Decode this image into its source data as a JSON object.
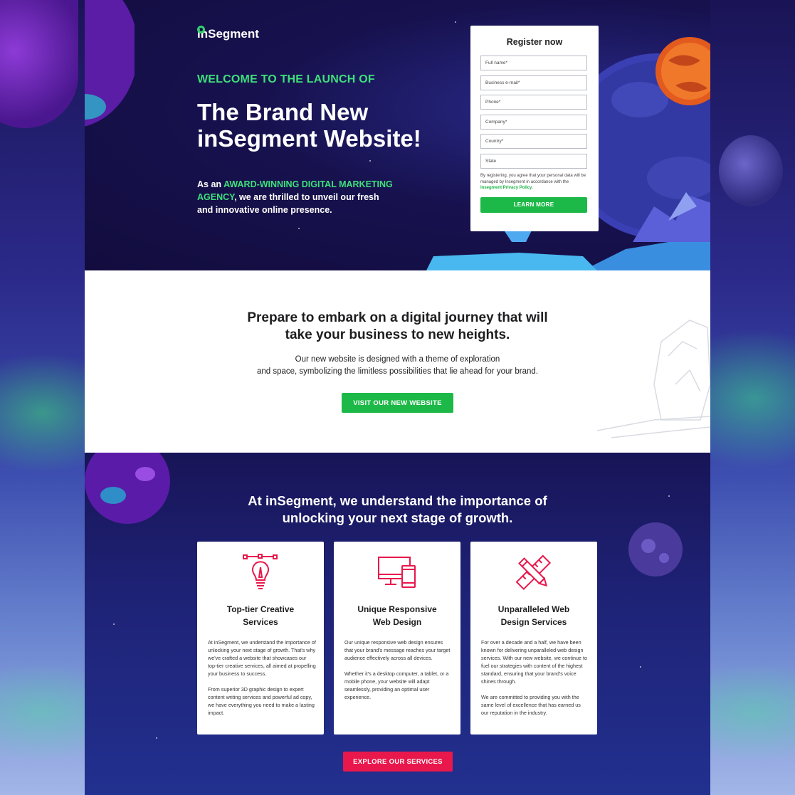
{
  "logo": {
    "text": "inSegment"
  },
  "hero": {
    "kicker": "WELCOME TO THE LAUNCH OF",
    "title_line1": "The Brand New",
    "title_line2": "inSegment Website!",
    "body_prefix": "As an ",
    "body_highlight": "AWARD-WINNING DIGITAL MARKETING AGENCY",
    "body_suffix": ", we are thrilled to unveil our fresh and innovative online presence."
  },
  "form": {
    "title": "Register now",
    "fields": [
      {
        "placeholder": "Full name*"
      },
      {
        "placeholder": "Business e-mail*"
      },
      {
        "placeholder": "Phone*"
      },
      {
        "placeholder": "Company*"
      },
      {
        "placeholder": "Country*"
      },
      {
        "placeholder": "State"
      }
    ],
    "note_prefix": "By registering, you agree that your personal data will be managed by Insegment in accordance with the ",
    "note_link": "Insegment Privacy Policy",
    "note_suffix": ".",
    "submit_label": "LEARN MORE"
  },
  "journey": {
    "title_line1": "Prepare to embark on a digital journey that will",
    "title_line2": "take your business to new heights.",
    "body_line1": "Our new website is designed with a theme of exploration",
    "body_line2": "and space, symbolizing the limitless possibilities that lie ahead for your brand.",
    "button_label": "VISIT OUR NEW WEBSITE"
  },
  "services": {
    "title_line1": "At inSegment, we understand the importance of",
    "title_line2": "unlocking your next stage of growth.",
    "cards": [
      {
        "icon": "lightbulb-pencil-icon",
        "title_line1": "Top-tier Creative",
        "title_line2": "Services",
        "paragraphs": [
          "At inSegment, we understand the importance of unlocking your next stage of growth. That's why we've crafted a website that showcases our top-tier creative services, all aimed at propelling your business to success.",
          "From superior 3D graphic design to expert content writing services and powerful ad copy, we have everything you need to make a lasting impact."
        ]
      },
      {
        "icon": "devices-icon",
        "title_line1": "Unique Responsive",
        "title_line2": "Web Design",
        "paragraphs": [
          "Our unique responsive web design ensures that your brand's message reaches your target audience effectively across all devices.",
          "Whether it's a desktop computer, a tablet, or a mobile phone, your website will adapt seamlessly, providing an optimal user experience."
        ]
      },
      {
        "icon": "ruler-pencil-icon",
        "title_line1": "Unparalleled Web",
        "title_line2": "Design Services",
        "paragraphs": [
          "For over a decade and a half, we have been known for delivering unparalleled web design services. With our new website, we continue to fuel our strategies with content of the highest standard, ensuring that your brand's voice shines through.",
          "We are committed to providing you with the same level of excellence that has earned us our reputation in the industry."
        ]
      }
    ],
    "button_label": "EXPLORE OUR SERVICES"
  },
  "colors": {
    "green": "#1db948",
    "red": "#e8184c",
    "navy": "#17124f"
  }
}
